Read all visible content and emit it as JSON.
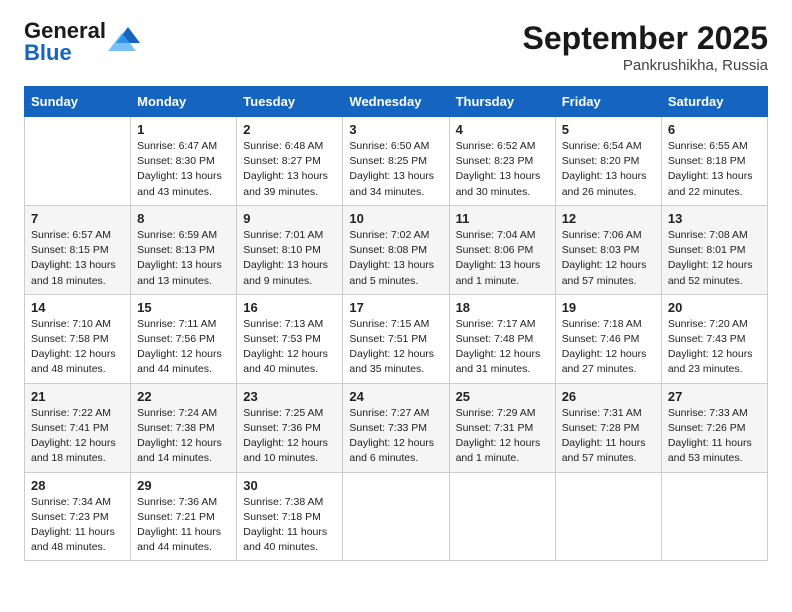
{
  "logo": {
    "general": "General",
    "blue": "Blue"
  },
  "title": "September 2025",
  "location": "Pankrushikha, Russia",
  "days_of_week": [
    "Sunday",
    "Monday",
    "Tuesday",
    "Wednesday",
    "Thursday",
    "Friday",
    "Saturday"
  ],
  "weeks": [
    [
      {
        "day": "",
        "text": ""
      },
      {
        "day": "1",
        "text": "Sunrise: 6:47 AM\nSunset: 8:30 PM\nDaylight: 13 hours\nand 43 minutes."
      },
      {
        "day": "2",
        "text": "Sunrise: 6:48 AM\nSunset: 8:27 PM\nDaylight: 13 hours\nand 39 minutes."
      },
      {
        "day": "3",
        "text": "Sunrise: 6:50 AM\nSunset: 8:25 PM\nDaylight: 13 hours\nand 34 minutes."
      },
      {
        "day": "4",
        "text": "Sunrise: 6:52 AM\nSunset: 8:23 PM\nDaylight: 13 hours\nand 30 minutes."
      },
      {
        "day": "5",
        "text": "Sunrise: 6:54 AM\nSunset: 8:20 PM\nDaylight: 13 hours\nand 26 minutes."
      },
      {
        "day": "6",
        "text": "Sunrise: 6:55 AM\nSunset: 8:18 PM\nDaylight: 13 hours\nand 22 minutes."
      }
    ],
    [
      {
        "day": "7",
        "text": "Sunrise: 6:57 AM\nSunset: 8:15 PM\nDaylight: 13 hours\nand 18 minutes."
      },
      {
        "day": "8",
        "text": "Sunrise: 6:59 AM\nSunset: 8:13 PM\nDaylight: 13 hours\nand 13 minutes."
      },
      {
        "day": "9",
        "text": "Sunrise: 7:01 AM\nSunset: 8:10 PM\nDaylight: 13 hours\nand 9 minutes."
      },
      {
        "day": "10",
        "text": "Sunrise: 7:02 AM\nSunset: 8:08 PM\nDaylight: 13 hours\nand 5 minutes."
      },
      {
        "day": "11",
        "text": "Sunrise: 7:04 AM\nSunset: 8:06 PM\nDaylight: 13 hours\nand 1 minute."
      },
      {
        "day": "12",
        "text": "Sunrise: 7:06 AM\nSunset: 8:03 PM\nDaylight: 12 hours\nand 57 minutes."
      },
      {
        "day": "13",
        "text": "Sunrise: 7:08 AM\nSunset: 8:01 PM\nDaylight: 12 hours\nand 52 minutes."
      }
    ],
    [
      {
        "day": "14",
        "text": "Sunrise: 7:10 AM\nSunset: 7:58 PM\nDaylight: 12 hours\nand 48 minutes."
      },
      {
        "day": "15",
        "text": "Sunrise: 7:11 AM\nSunset: 7:56 PM\nDaylight: 12 hours\nand 44 minutes."
      },
      {
        "day": "16",
        "text": "Sunrise: 7:13 AM\nSunset: 7:53 PM\nDaylight: 12 hours\nand 40 minutes."
      },
      {
        "day": "17",
        "text": "Sunrise: 7:15 AM\nSunset: 7:51 PM\nDaylight: 12 hours\nand 35 minutes."
      },
      {
        "day": "18",
        "text": "Sunrise: 7:17 AM\nSunset: 7:48 PM\nDaylight: 12 hours\nand 31 minutes."
      },
      {
        "day": "19",
        "text": "Sunrise: 7:18 AM\nSunset: 7:46 PM\nDaylight: 12 hours\nand 27 minutes."
      },
      {
        "day": "20",
        "text": "Sunrise: 7:20 AM\nSunset: 7:43 PM\nDaylight: 12 hours\nand 23 minutes."
      }
    ],
    [
      {
        "day": "21",
        "text": "Sunrise: 7:22 AM\nSunset: 7:41 PM\nDaylight: 12 hours\nand 18 minutes."
      },
      {
        "day": "22",
        "text": "Sunrise: 7:24 AM\nSunset: 7:38 PM\nDaylight: 12 hours\nand 14 minutes."
      },
      {
        "day": "23",
        "text": "Sunrise: 7:25 AM\nSunset: 7:36 PM\nDaylight: 12 hours\nand 10 minutes."
      },
      {
        "day": "24",
        "text": "Sunrise: 7:27 AM\nSunset: 7:33 PM\nDaylight: 12 hours\nand 6 minutes."
      },
      {
        "day": "25",
        "text": "Sunrise: 7:29 AM\nSunset: 7:31 PM\nDaylight: 12 hours\nand 1 minute."
      },
      {
        "day": "26",
        "text": "Sunrise: 7:31 AM\nSunset: 7:28 PM\nDaylight: 11 hours\nand 57 minutes."
      },
      {
        "day": "27",
        "text": "Sunrise: 7:33 AM\nSunset: 7:26 PM\nDaylight: 11 hours\nand 53 minutes."
      }
    ],
    [
      {
        "day": "28",
        "text": "Sunrise: 7:34 AM\nSunset: 7:23 PM\nDaylight: 11 hours\nand 48 minutes."
      },
      {
        "day": "29",
        "text": "Sunrise: 7:36 AM\nSunset: 7:21 PM\nDaylight: 11 hours\nand 44 minutes."
      },
      {
        "day": "30",
        "text": "Sunrise: 7:38 AM\nSunset: 7:18 PM\nDaylight: 11 hours\nand 40 minutes."
      },
      {
        "day": "",
        "text": ""
      },
      {
        "day": "",
        "text": ""
      },
      {
        "day": "",
        "text": ""
      },
      {
        "day": "",
        "text": ""
      }
    ]
  ]
}
